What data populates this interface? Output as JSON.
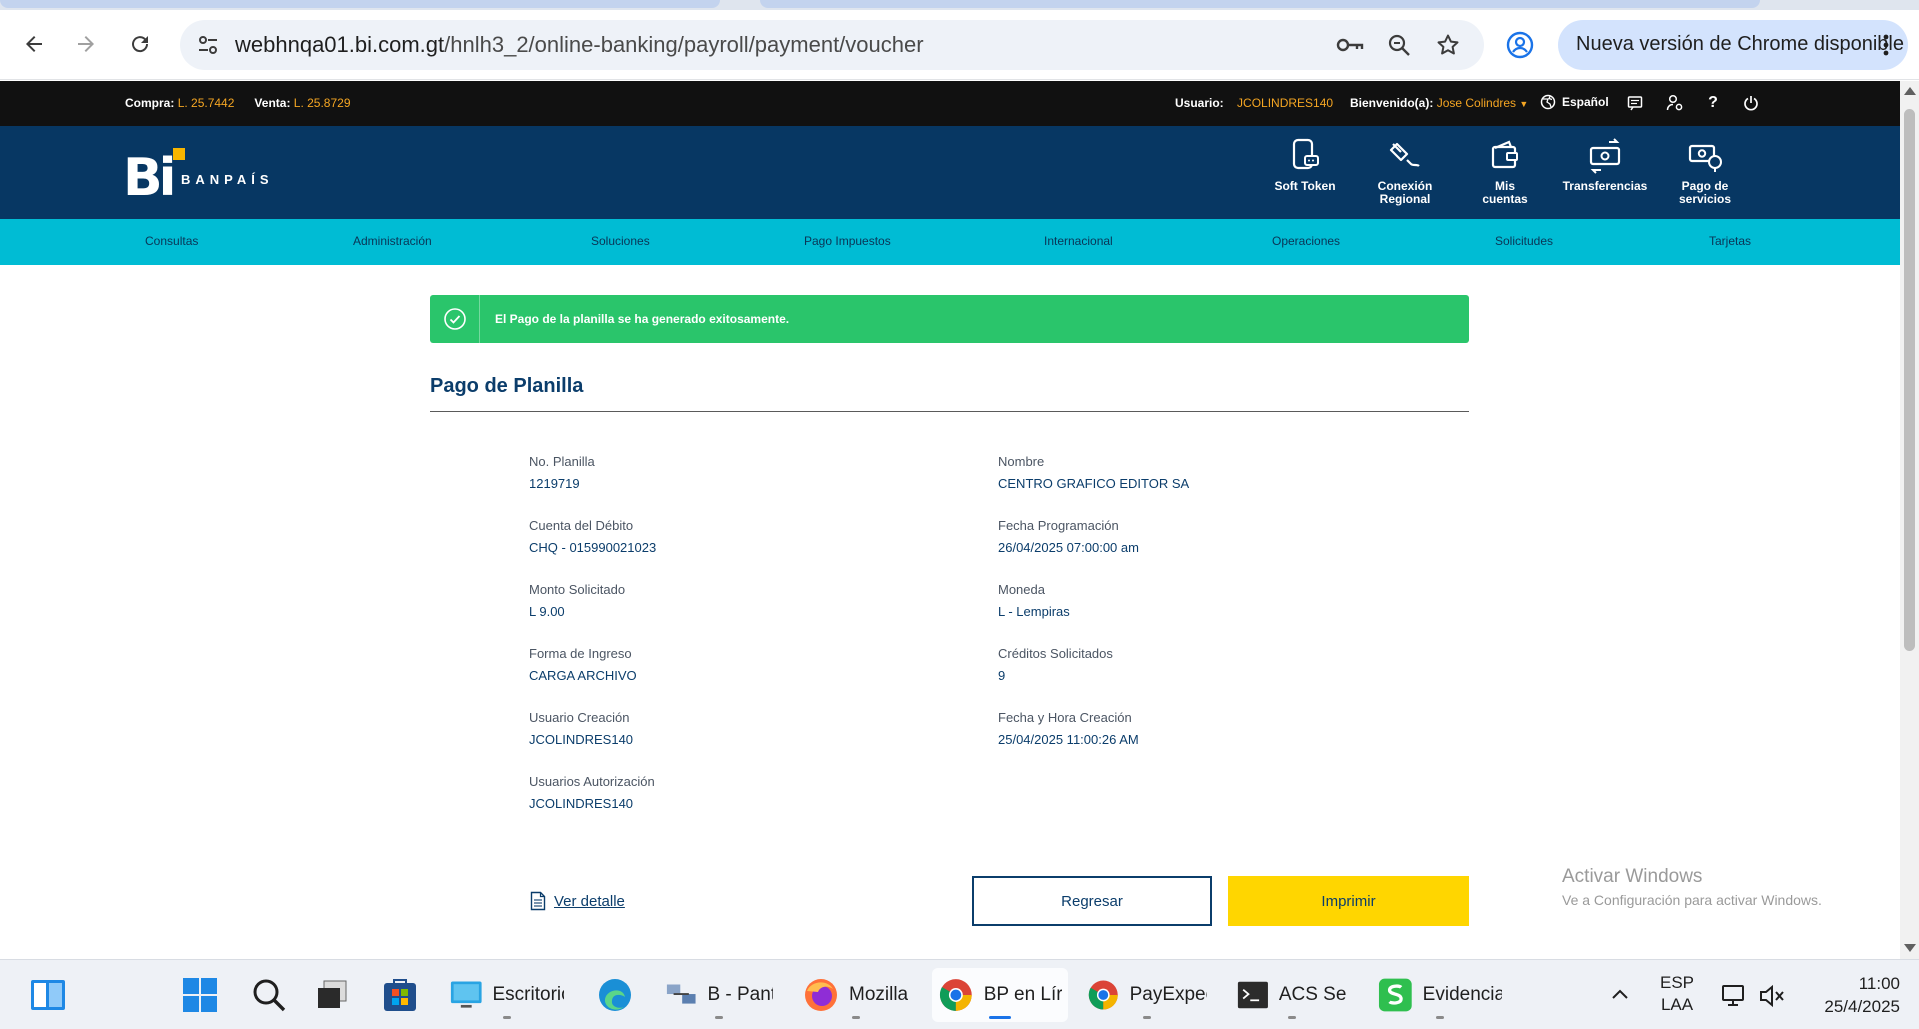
{
  "browser": {
    "url_host": "webhnqa01.bi.com.gt",
    "url_path": "/hnlh3_2/online-banking/payroll/payment/voucher",
    "update_label": "Nueva versión de Chrome disponible"
  },
  "topbar": {
    "buy_label": "Compra:",
    "buy_value": "L. 25.7442",
    "sell_label": "Venta:",
    "sell_value": "L. 25.8729",
    "user_label": "Usuario:",
    "user_value": "JCOLINDRES140",
    "welcome_label": "Bienvenido(a):",
    "welcome_value": "Jose Colindres",
    "language": "Español"
  },
  "brand": {
    "logo_text": "Bi",
    "logo_name": "BANPAÍS",
    "quick_links": [
      {
        "l1": "Soft Token",
        "l2": ""
      },
      {
        "l1": "Conexión",
        "l2": "Regional"
      },
      {
        "l1": "Mis",
        "l2": "cuentas"
      },
      {
        "l1": "Transferencias",
        "l2": ""
      },
      {
        "l1": "Pago de",
        "l2": "servicios"
      }
    ]
  },
  "menu": [
    "Consultas",
    "Administración",
    "Soluciones",
    "Pago Impuestos",
    "Internacional",
    "Operaciones",
    "Solicitudes",
    "Tarjetas"
  ],
  "alert": {
    "message": "El Pago de la planilla se ha generado exitosamente."
  },
  "page": {
    "title": "Pago de Planilla",
    "fields": [
      {
        "label": "No. Planilla",
        "value": "1219719"
      },
      {
        "label": "Nombre",
        "value": "CENTRO GRAFICO EDITOR SA"
      },
      {
        "label": "Cuenta del Débito",
        "value": "CHQ - 015990021023"
      },
      {
        "label": "Fecha Programación",
        "value": "26/04/2025 07:00:00 am"
      },
      {
        "label": "Monto Solicitado",
        "value": "L 9.00"
      },
      {
        "label": "Moneda",
        "value": "L - Lempiras"
      },
      {
        "label": "Forma de Ingreso",
        "value": "CARGA ARCHIVO"
      },
      {
        "label": "Créditos Solicitados",
        "value": "9"
      },
      {
        "label": "Usuario Creación",
        "value": "JCOLINDRES140"
      },
      {
        "label": "Fecha y Hora Creación",
        "value": "25/04/2025 11:00:26 AM"
      },
      {
        "label": "Usuarios Autorización",
        "value": "JCOLINDRES140"
      }
    ],
    "detail_link": "Ver detalle",
    "back_button": "Regresar",
    "print_button": "Imprimir"
  },
  "watermark": {
    "line1": "Activar Windows",
    "line2": "Ve a Configuración para activar Windows."
  },
  "taskbar": {
    "apps": [
      {
        "label": "Escritorio"
      },
      {
        "label": "B - Pant"
      },
      {
        "label": "Mozilla"
      },
      {
        "label": "BP en Lír"
      },
      {
        "label": "PayExpec"
      },
      {
        "label": "ACS Ses"
      },
      {
        "label": "Evidencia"
      }
    ],
    "lang1": "ESP",
    "lang2": "LAA",
    "time": "11:00",
    "date": "25/4/2025"
  },
  "colors": {
    "header_navy": "#073763",
    "menu_cyan": "#00bcd4",
    "success_green": "#2ac56b",
    "print_yellow": "#ffd600",
    "accent_orange": "#f5a623"
  }
}
